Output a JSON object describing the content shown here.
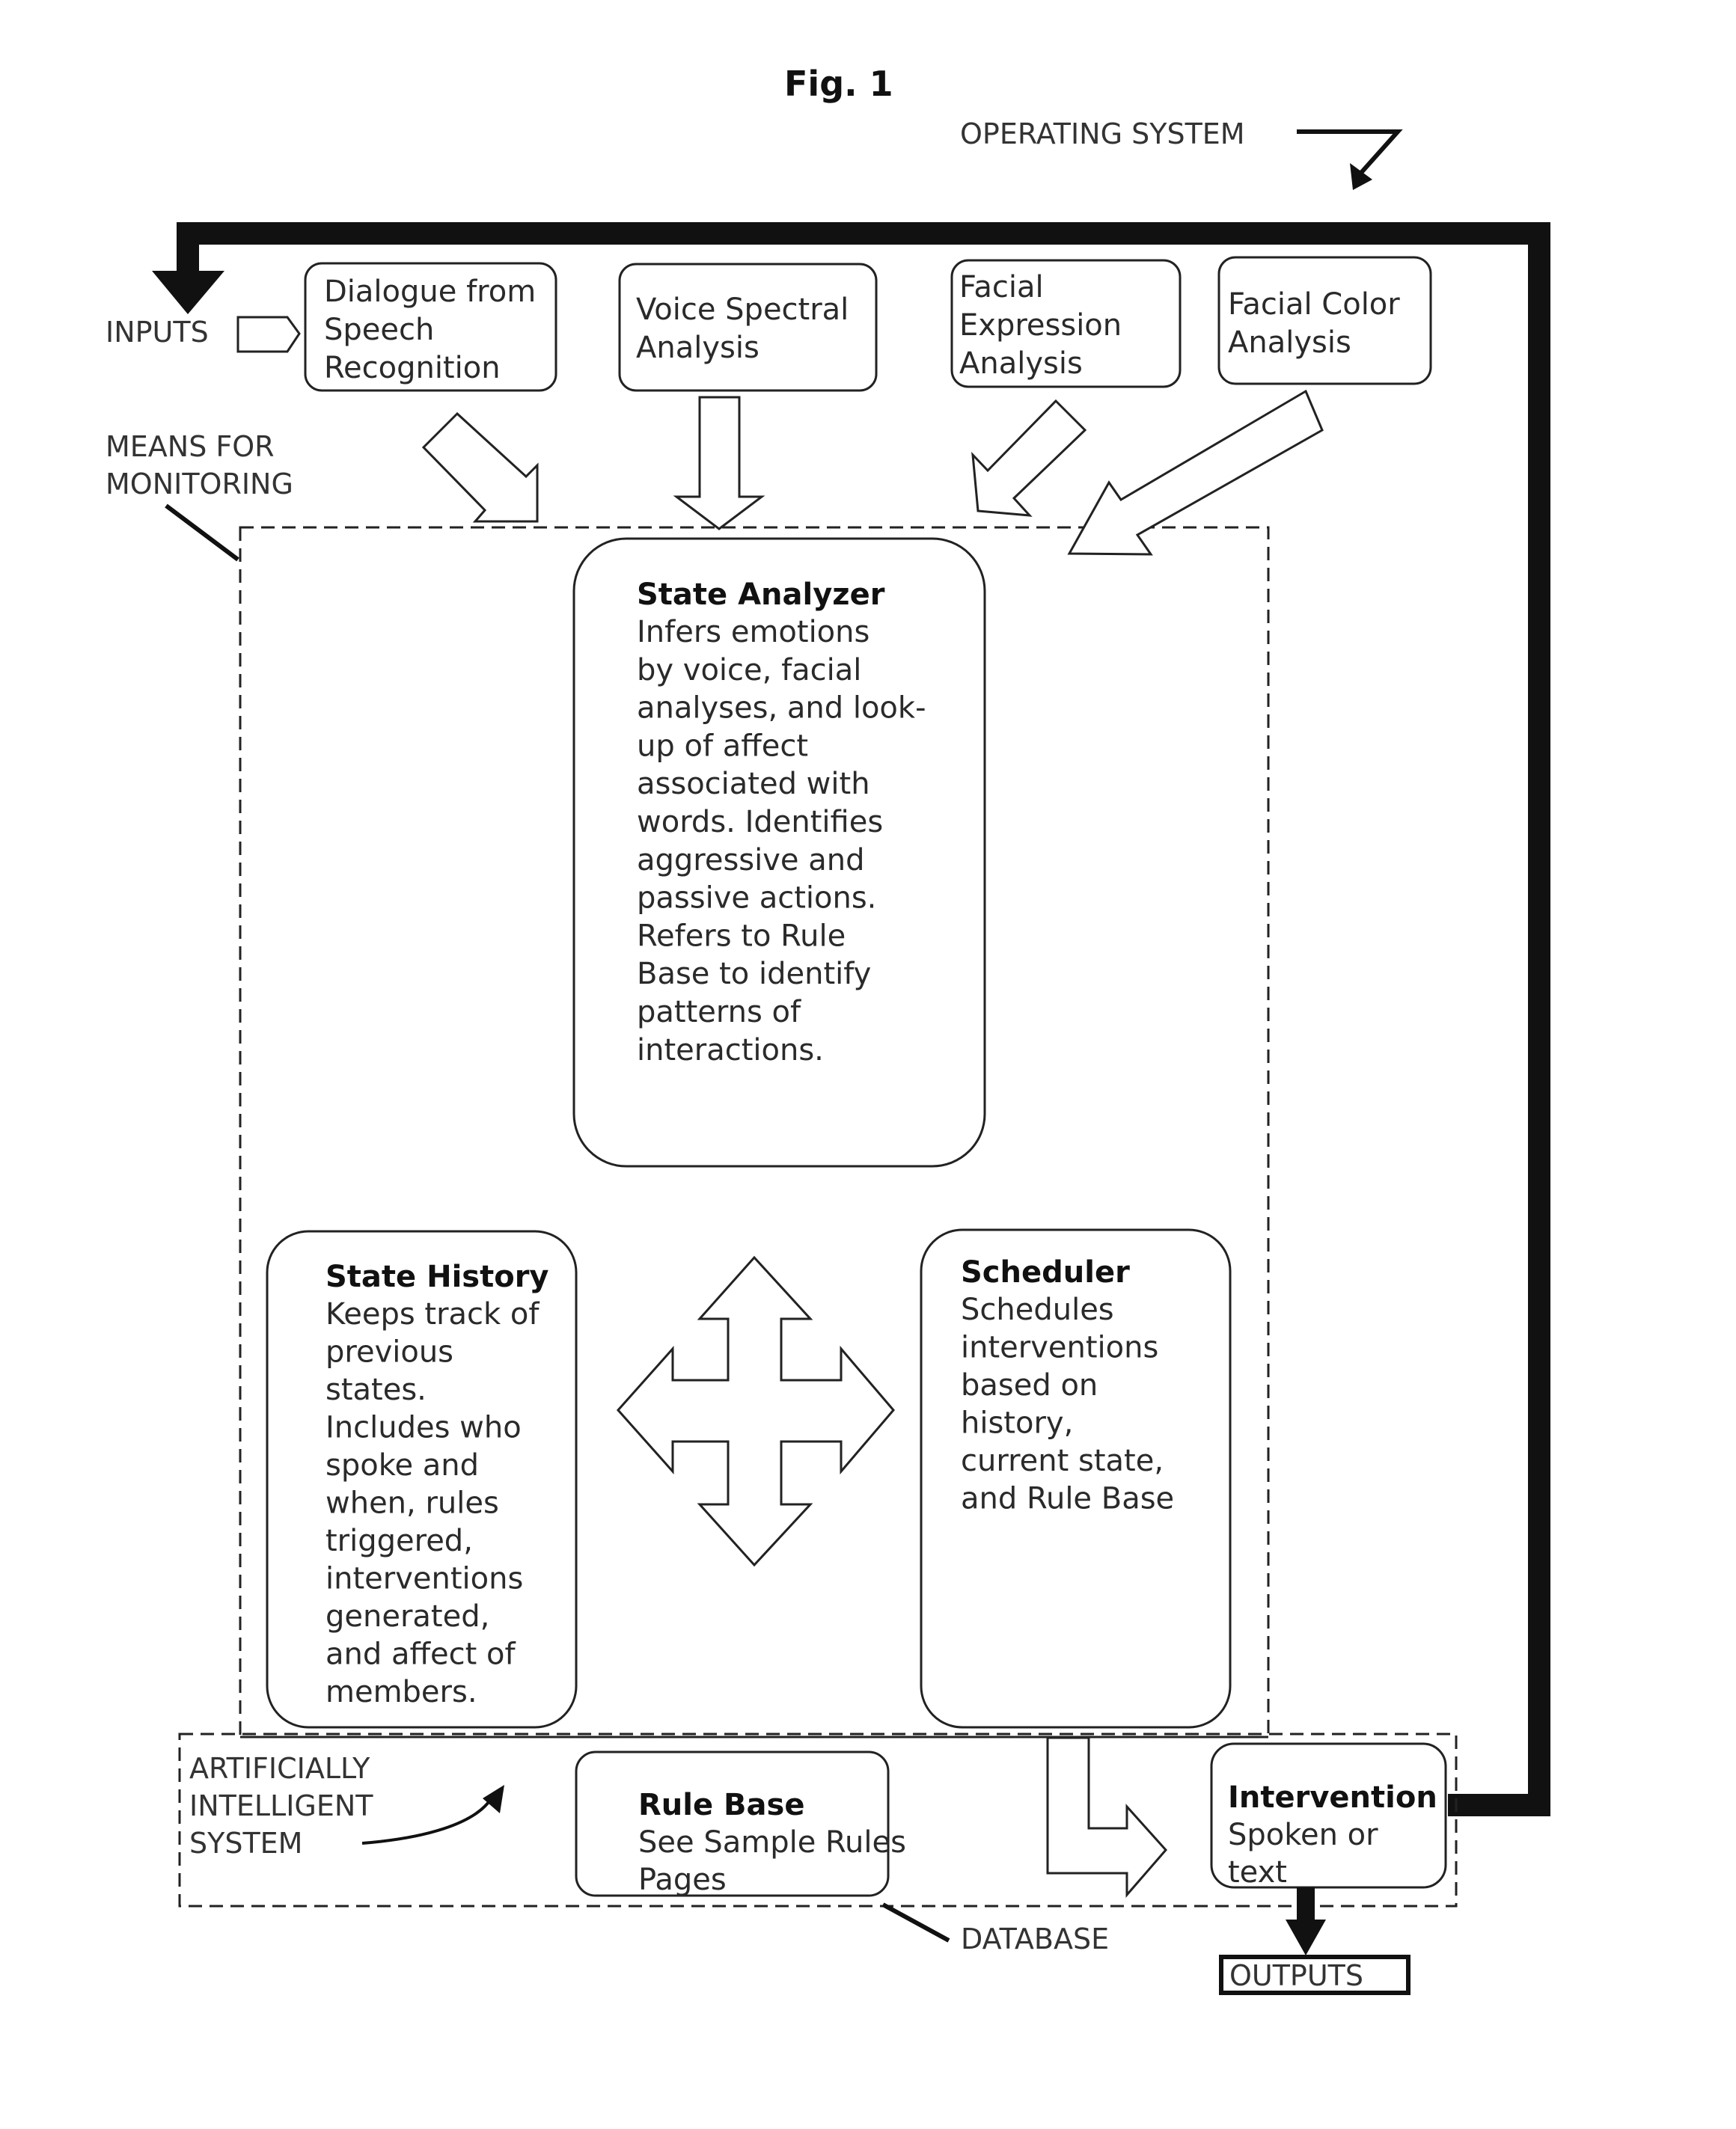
{
  "figure": {
    "title": "Fig. 1"
  },
  "labels": {
    "operating_system": "OPERATING SYSTEM",
    "inputs": "INPUTS",
    "means_for_monitoring": [
      "MEANS FOR",
      "MONITORING"
    ],
    "artificially_intelligent_system": [
      "ARTIFICIALLY",
      "INTELLIGENT",
      "SYSTEM"
    ],
    "database": "DATABASE",
    "outputs": "OUTPUTS"
  },
  "inputs": [
    {
      "id": "dialogue",
      "lines": [
        "Dialogue from",
        "Speech",
        "Recognition"
      ]
    },
    {
      "id": "voice",
      "lines": [
        "Voice Spectral",
        "Analysis"
      ]
    },
    {
      "id": "facial-expression",
      "lines": [
        "Facial",
        "Expression",
        "Analysis"
      ]
    },
    {
      "id": "facial-color",
      "lines": [
        "Facial Color",
        "Analysis"
      ]
    }
  ],
  "state_analyzer": {
    "title": "State Analyzer",
    "lines": [
      "Infers emotions",
      "by voice,  facial",
      "analyses, and look-",
      "up of affect",
      "associated with",
      "words. Identifies",
      "aggressive and",
      "passive actions.",
      "Refers to Rule",
      "Base to identify",
      "patterns of",
      "interactions."
    ]
  },
  "state_history": {
    "title": "State History",
    "lines": [
      "Keeps track of",
      "previous",
      "states.",
      "Includes who",
      "spoke and",
      "when, rules",
      "triggered,",
      "interventions",
      "generated,",
      "and affect of",
      "members."
    ]
  },
  "scheduler": {
    "title": "Scheduler",
    "lines": [
      "Schedules",
      "interventions",
      "based on",
      "history,",
      "current state,",
      "and Rule Base"
    ]
  },
  "rule_base": {
    "title": "Rule Base",
    "lines": [
      "See Sample Rules",
      "Pages"
    ]
  },
  "intervention": {
    "title": "Intervention",
    "lines": [
      "Spoken or",
      "text"
    ]
  }
}
